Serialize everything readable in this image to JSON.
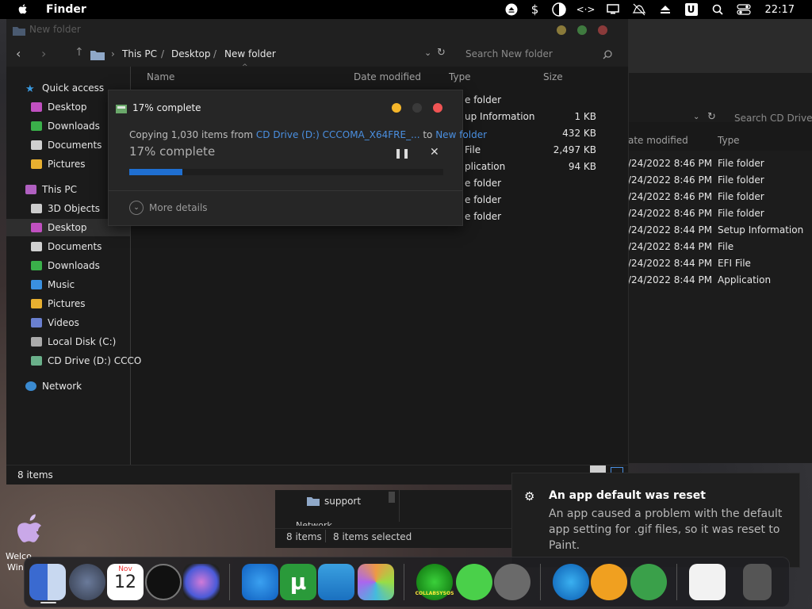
{
  "menubar": {
    "app_name": "Finder",
    "clock": "22:17",
    "icons": [
      "apple-logo-icon",
      "eject-circle-icon",
      "dollar-icon",
      "half-moon-icon",
      "code-arrows-icon",
      "display-icon",
      "notifications-off-icon",
      "eject-icon",
      "u-badge-icon",
      "search-icon",
      "control-center-icon"
    ]
  },
  "main_window": {
    "title": "New folder",
    "breadcrumb": [
      "This PC",
      "Desktop",
      "New folder"
    ],
    "search_placeholder": "Search New folder",
    "columns": {
      "name": "Name",
      "date": "Date modified",
      "type": "Type",
      "size": "Size"
    },
    "rows": [
      {
        "type": "e folder",
        "size": ""
      },
      {
        "type": "up Information",
        "size": "1 KB"
      },
      {
        "type": "",
        "size": "432 KB"
      },
      {
        "type": "File",
        "size": "2,497 KB"
      },
      {
        "type": "plication",
        "size": "94 KB"
      },
      {
        "type": "e folder",
        "size": ""
      },
      {
        "type": "e folder",
        "size": ""
      },
      {
        "type": "e folder",
        "size": ""
      }
    ],
    "status": "8 items"
  },
  "sidebar": {
    "quick_access": "Quick access",
    "quick_items": [
      "Desktop",
      "Downloads",
      "Documents",
      "Pictures"
    ],
    "this_pc": "This PC",
    "pc_items": [
      "3D Objects",
      "Desktop",
      "Documents",
      "Downloads",
      "Music",
      "Pictures",
      "Videos",
      "Local Disk (C:)",
      "CD Drive (D:) CCCO"
    ],
    "network": "Network"
  },
  "copy_dialog": {
    "title": "17% complete",
    "copying_prefix": "Copying 1,030 items from ",
    "source": "CD Drive (D:) CCCOMA_X64FRE_...",
    "to_word": " to ",
    "destination": "New folder",
    "percent_text": "17% complete",
    "progress": 0.17,
    "more_details": "More details",
    "colors": {
      "progress": "#1f6fd1",
      "link": "#4a8fe0"
    }
  },
  "back_window": {
    "search_placeholder": "Search CD Drive (D",
    "columns": {
      "date": "ate modified",
      "type": "Type"
    },
    "rows": [
      {
        "date": "/24/2022 8:46 PM",
        "type": "File folder"
      },
      {
        "date": "/24/2022 8:46 PM",
        "type": "File folder"
      },
      {
        "date": "/24/2022 8:46 PM",
        "type": "File folder"
      },
      {
        "date": "/24/2022 8:46 PM",
        "type": "File folder"
      },
      {
        "date": "/24/2022 8:44 PM",
        "type": "Setup Information"
      },
      {
        "date": "/24/2022 8:44 PM",
        "type": "File"
      },
      {
        "date": "/24/2022 8:44 PM",
        "type": "EFI File"
      },
      {
        "date": "/24/2022 8:44 PM",
        "type": "Application"
      }
    ]
  },
  "lower_window": {
    "folder": "support",
    "network": "Network",
    "items": "8 items",
    "selected": "8 items selected"
  },
  "toast": {
    "title": "An app default was reset",
    "message": "An app caused a problem with the default app setting for .gif files, so it was reset to Paint."
  },
  "desktop": {
    "label_line1": "Welco",
    "label_line2": "Win"
  },
  "dock": {
    "calendar_month": "Nov",
    "calendar_day": "12",
    "collab_label": "COLLABSYSOS"
  }
}
